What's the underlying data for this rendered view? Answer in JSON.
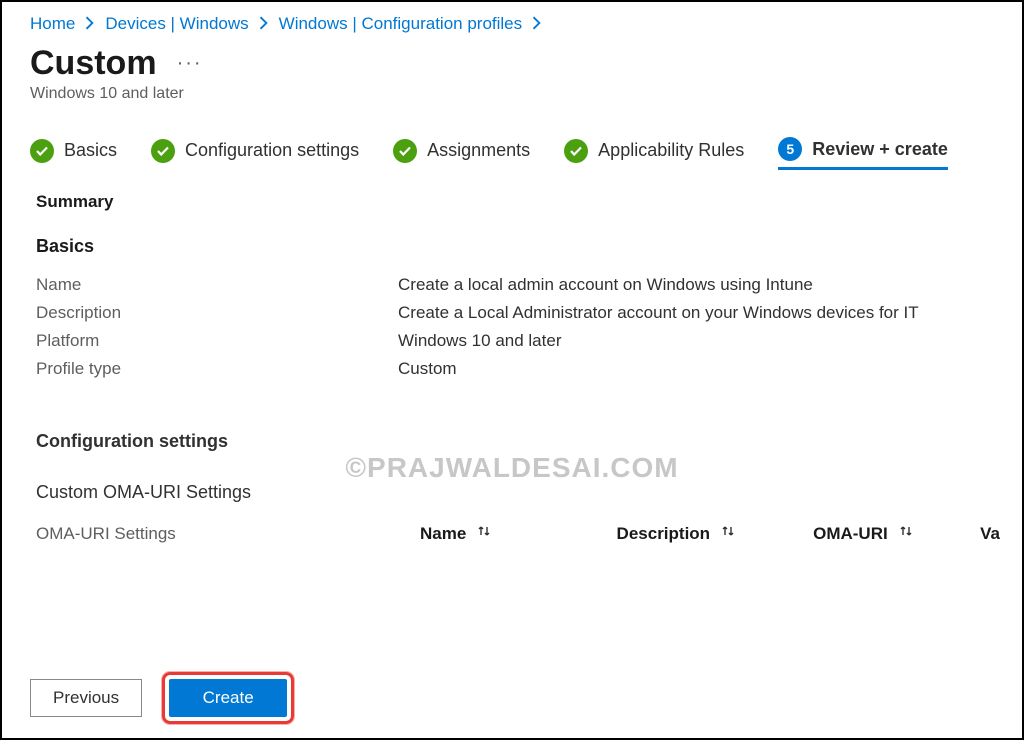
{
  "breadcrumb": {
    "items": [
      {
        "label": "Home"
      },
      {
        "label": "Devices | Windows"
      },
      {
        "label": "Windows | Configuration profiles"
      }
    ]
  },
  "header": {
    "title": "Custom",
    "subtitle": "Windows 10 and later"
  },
  "steps": [
    {
      "label": "Basics",
      "state": "done"
    },
    {
      "label": "Configuration settings",
      "state": "done"
    },
    {
      "label": "Assignments",
      "state": "done"
    },
    {
      "label": "Applicability Rules",
      "state": "done"
    },
    {
      "label": "Review + create",
      "state": "current",
      "number": "5"
    }
  ],
  "summary_heading": "Summary",
  "basics": {
    "heading": "Basics",
    "rows": {
      "name_k": "Name",
      "name_v": "Create a local admin account on Windows using Intune",
      "desc_k": "Description",
      "desc_v": "Create a Local Administrator account on your Windows devices for IT",
      "plat_k": "Platform",
      "plat_v": "Windows 10 and later",
      "ptype_k": "Profile type",
      "ptype_v": "Custom"
    }
  },
  "config": {
    "heading": "Configuration settings",
    "custom_heading": "Custom OMA-URI Settings",
    "oma_label": "OMA-URI Settings",
    "columns": {
      "name": "Name",
      "desc": "Description",
      "oma": "OMA-URI",
      "val": "Va"
    }
  },
  "footer": {
    "previous": "Previous",
    "create": "Create"
  },
  "watermark": "©PRAJWALDESAI.COM"
}
